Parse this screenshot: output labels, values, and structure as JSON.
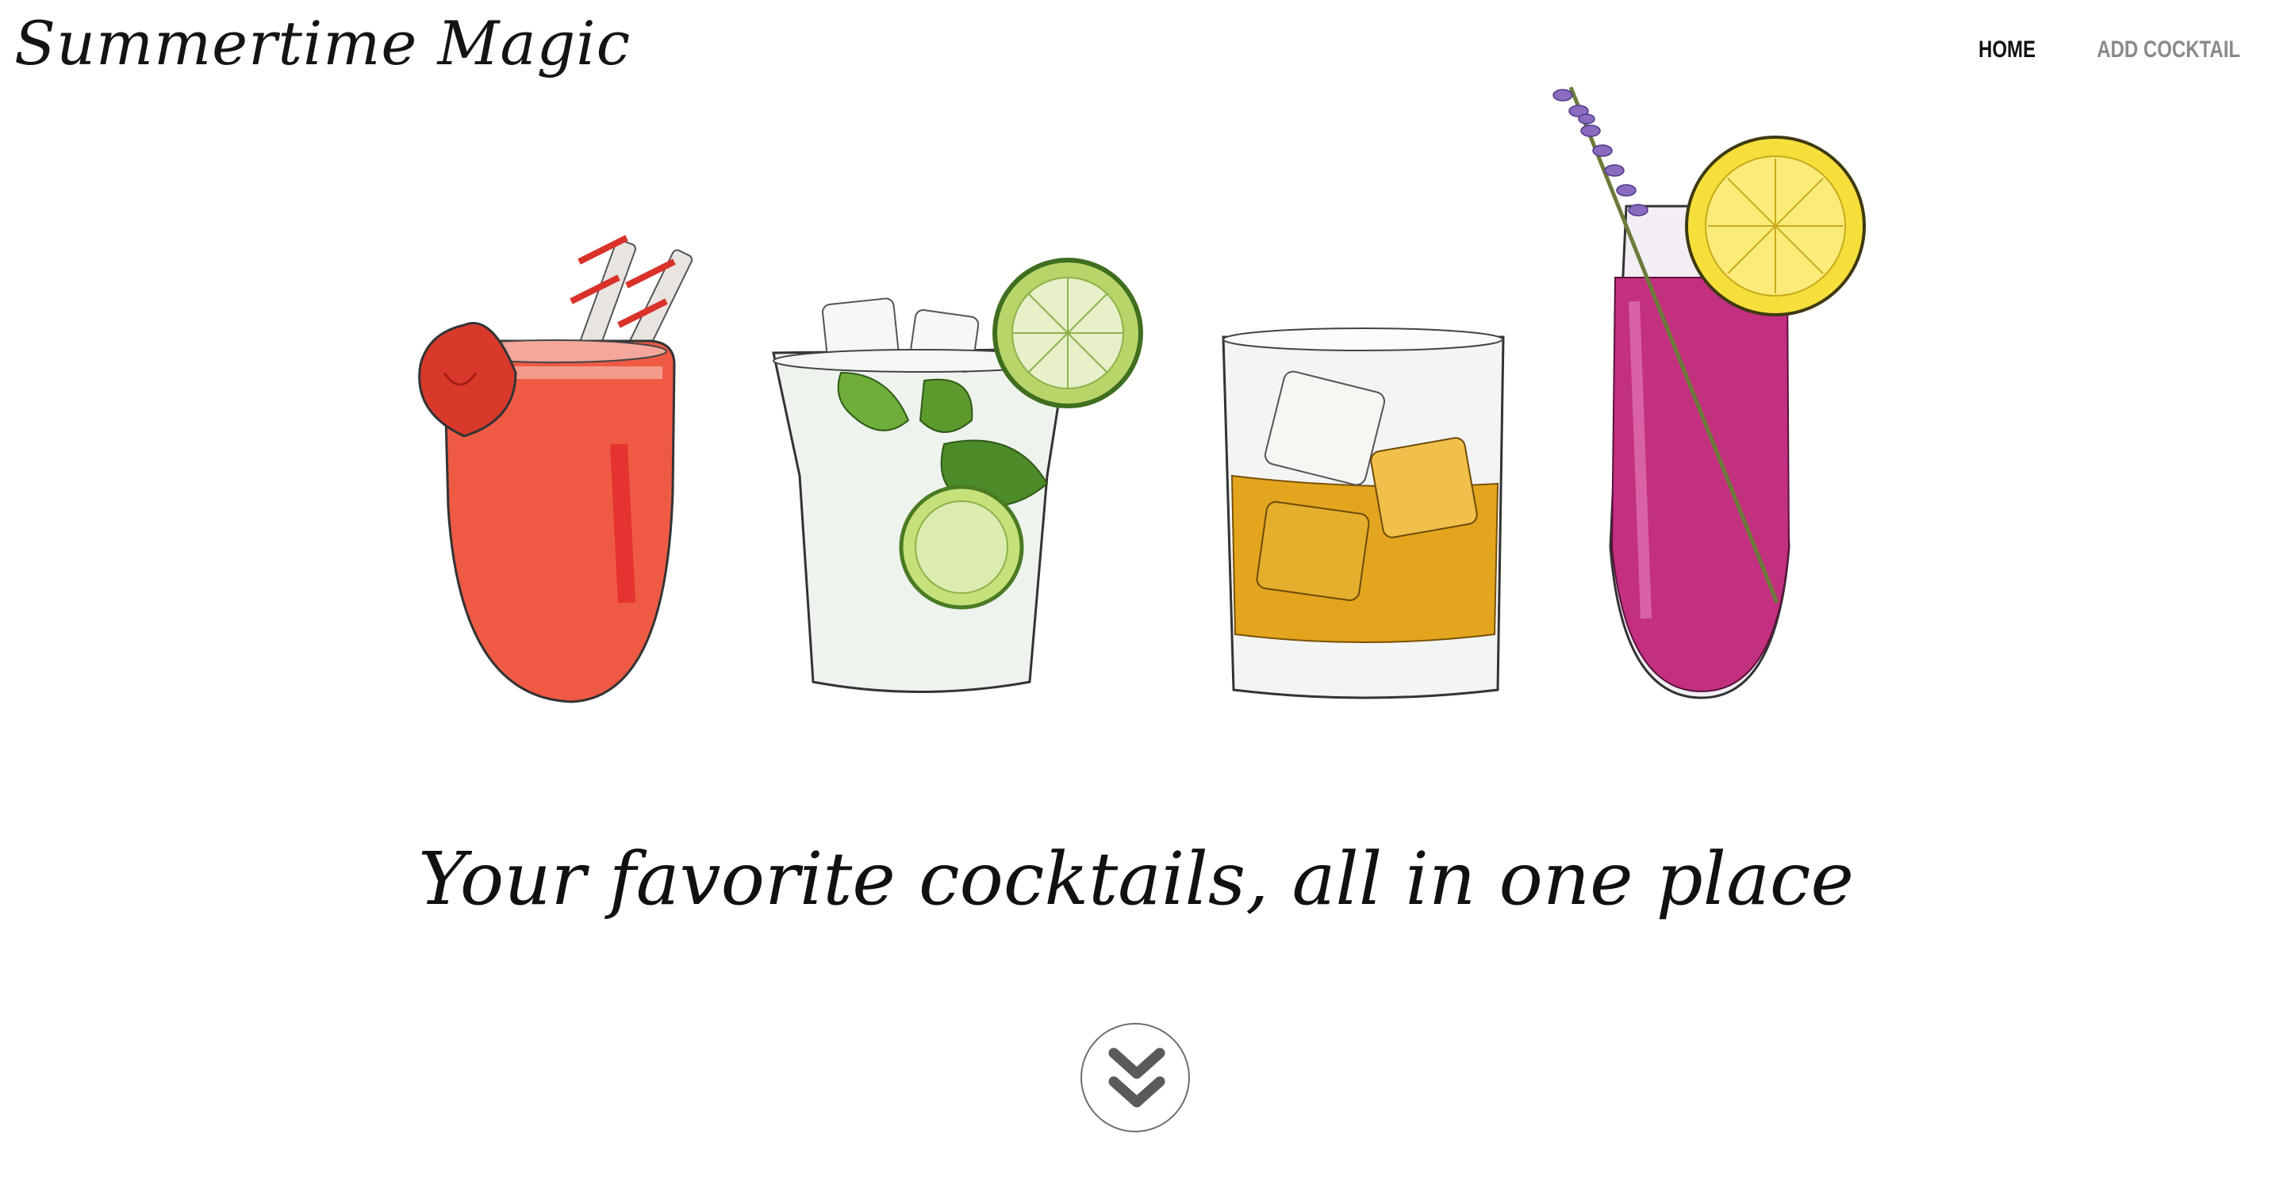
{
  "header": {
    "brand": "Summertime Magic",
    "nav": [
      {
        "label": "HOME",
        "active": true
      },
      {
        "label": "ADD COCKTAIL",
        "active": false
      }
    ]
  },
  "hero": {
    "illustration_items": [
      "strawberry-drink",
      "mojito",
      "whiskey-on-rocks",
      "lavender-lemon-drink"
    ],
    "tagline": "Your favorite cocktails, all in one place"
  },
  "scroll_button": {
    "icon": "double-chevron-down-icon"
  },
  "colors": {
    "text": "#111111",
    "nav_inactive": "#8a8a8a",
    "strawberry": "#ef5a45",
    "mojito_leaf": "#6fae3a",
    "whiskey": "#e3a51e",
    "lavender_drink": "#c2307f",
    "lemon": "#f6df3a"
  }
}
